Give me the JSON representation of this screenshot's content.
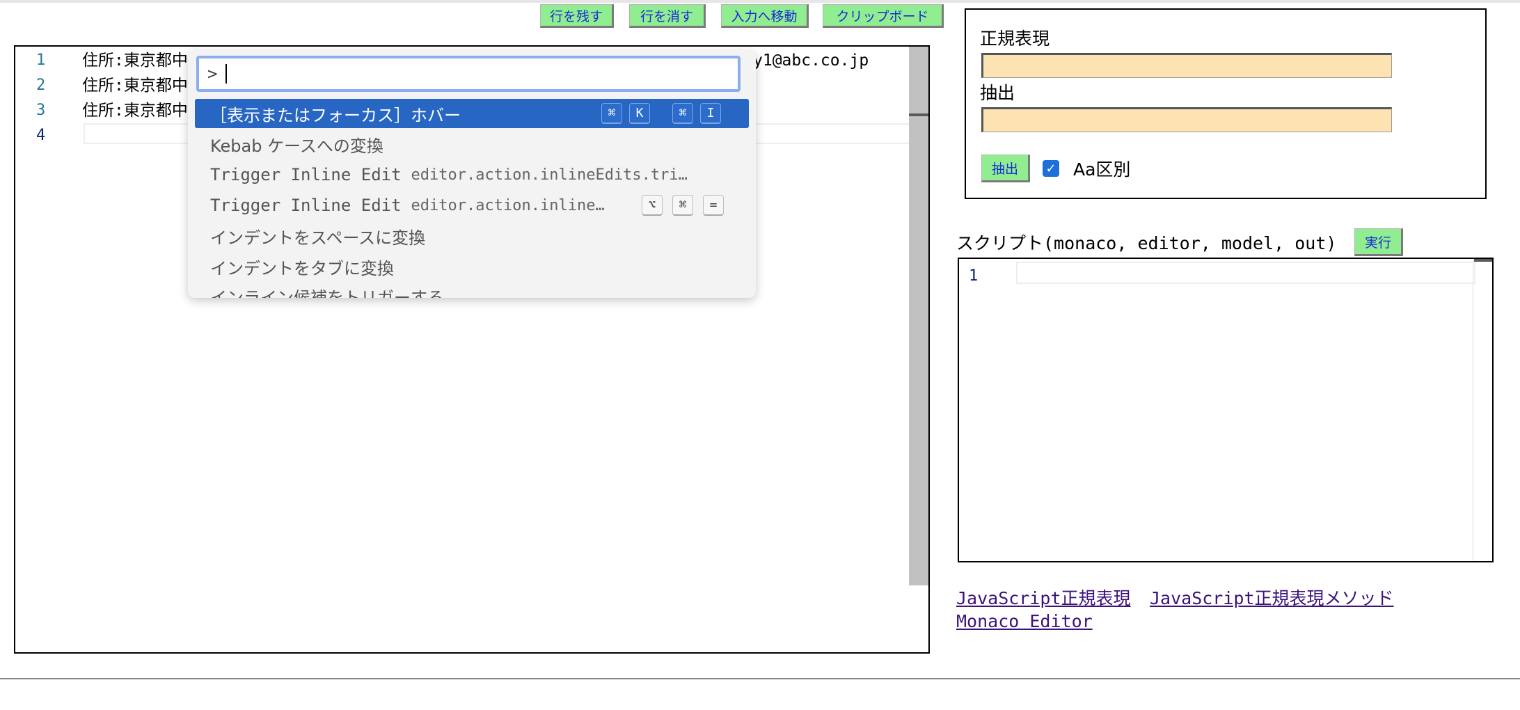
{
  "toolbar": {
    "keep_rows": "行を残す",
    "delete_rows": "行を消す",
    "move_to_input": "入力へ移動",
    "clipboard": "クリップボード"
  },
  "editor": {
    "lines": [
      {
        "number": "1",
        "text_left": "住所:東京都中",
        "text_right": "y1@abc.co.jp"
      },
      {
        "number": "2",
        "text_left": "住所:東京都中"
      },
      {
        "number": "3",
        "text_left": "住所:東京都中"
      },
      {
        "number": "4",
        "text_left": ""
      }
    ]
  },
  "command_palette": {
    "prompt": ">",
    "items": [
      {
        "label": "［表示またはフォーカス］ホバー",
        "keys": [
          "⌘",
          "K",
          "⌘",
          "I"
        ],
        "selected": true
      },
      {
        "label": "Kebab ケースへの変換"
      },
      {
        "label": "Trigger Inline Edit",
        "desc": "editor.action.inlineEdits.tri…"
      },
      {
        "label": "Trigger Inline Edit",
        "desc": "editor.action.inline…",
        "keys": [
          "⌥",
          "⌘",
          "="
        ]
      },
      {
        "label": "インデントをスペースに変換"
      },
      {
        "label": "インデントをタブに変換"
      },
      {
        "label": "インライン候補をトリガーする"
      }
    ]
  },
  "regex_panel": {
    "regex_label": "正規表現",
    "regex_value": "",
    "extract_label": "抽出",
    "extract_value": "",
    "extract_button": "抽出",
    "case_checkbox_label": "Aa区別",
    "case_checked": true
  },
  "script": {
    "title": "スクリプト(monaco, editor, model, out)",
    "run_button": "実行",
    "line_number": "1"
  },
  "links": {
    "js_regex": "JavaScript正規表現",
    "js_regex_methods": "JavaScript正規表現メソッド",
    "monaco_editor": "Monaco Editor"
  },
  "colors": {
    "button_bg": "#90ee90",
    "button_text": "#1a2ad8",
    "input_bg": "#fde2b2",
    "palette_selected": "#2866c3",
    "link": "#3d137b"
  }
}
